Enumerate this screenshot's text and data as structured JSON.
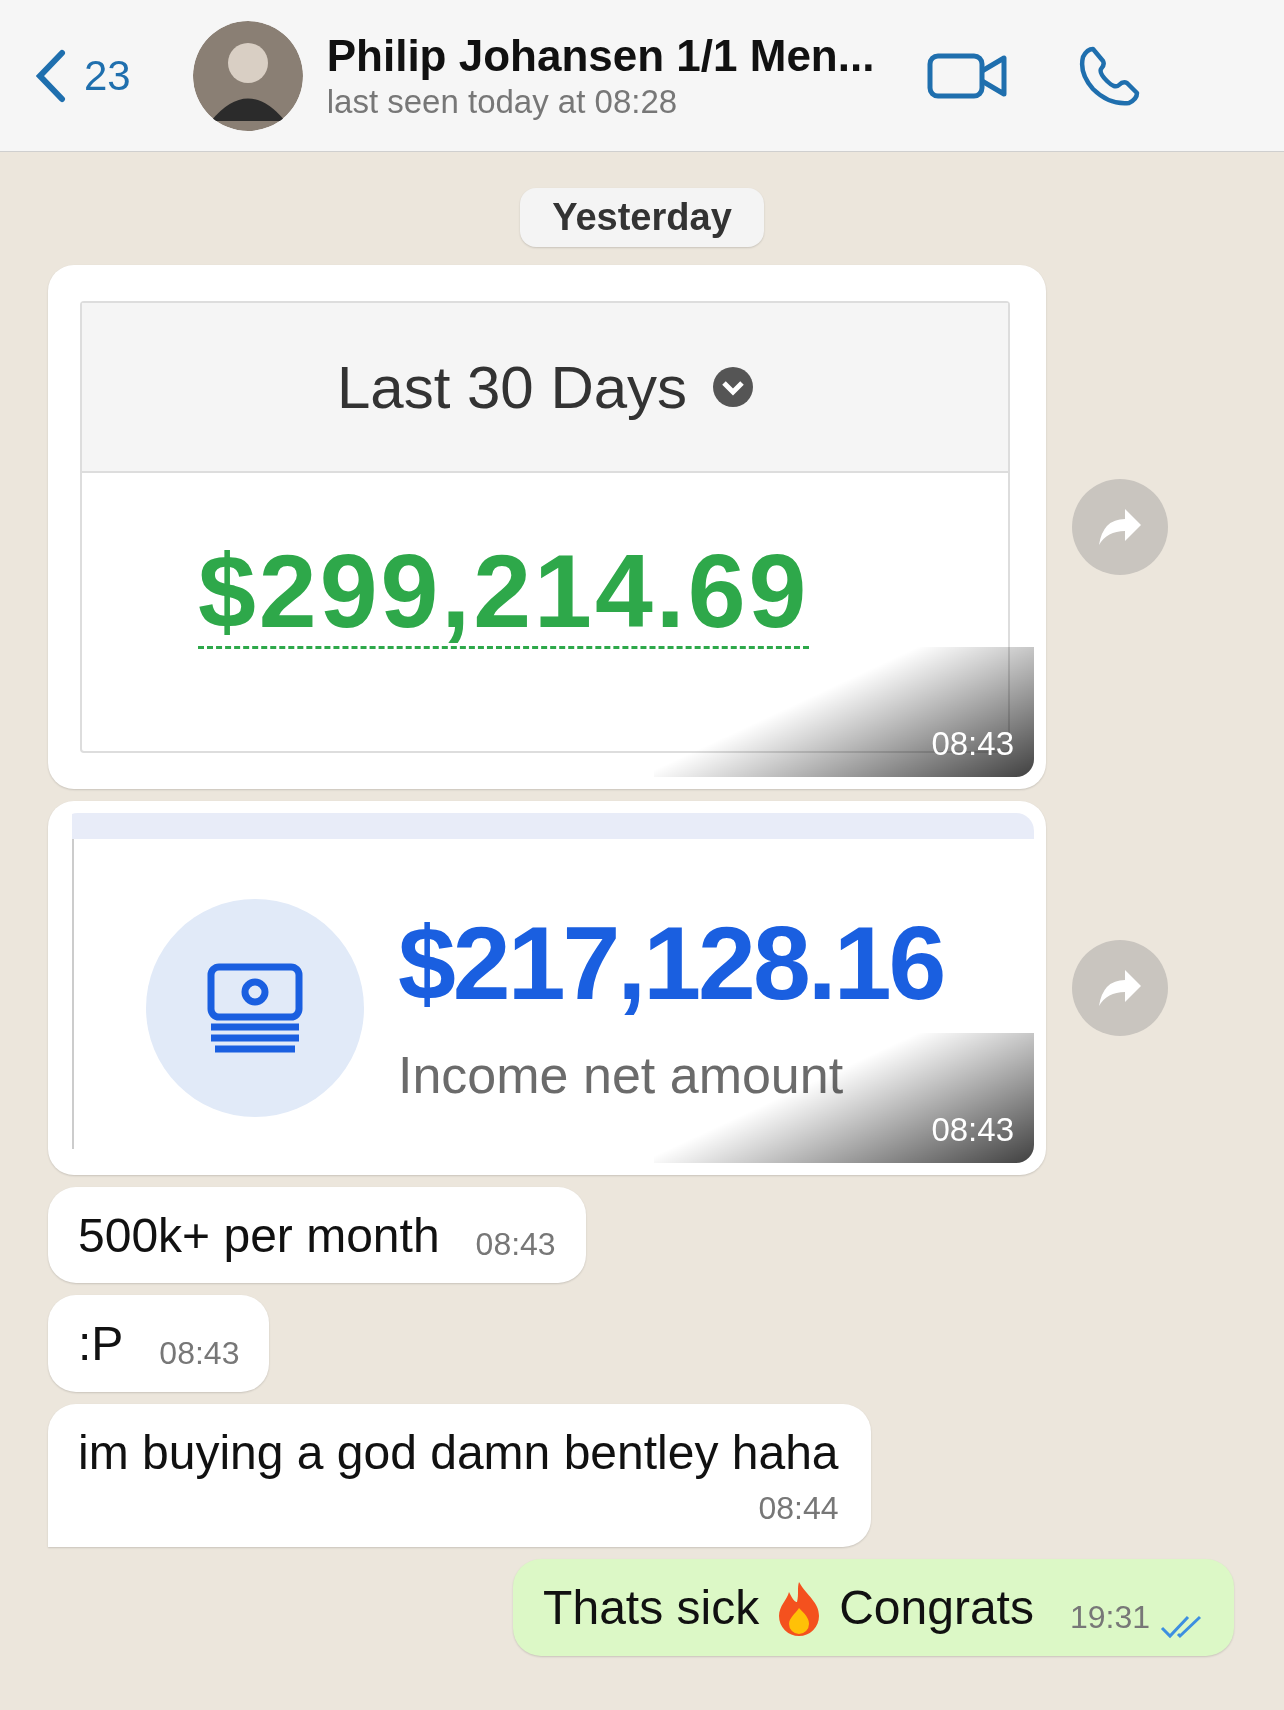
{
  "header": {
    "back_count": "23",
    "contact_name": "Philip Johansen 1/1 Men...",
    "status": "last seen today at 08:28"
  },
  "date_label": "Yesterday",
  "messages": [
    {
      "kind": "image",
      "outgoing": false,
      "image": {
        "kind": "stat_card",
        "period": "Last 30 Days",
        "amount": "$299,214.69"
      },
      "time": "08:43"
    },
    {
      "kind": "image",
      "outgoing": false,
      "image": {
        "kind": "income_card",
        "amount": "$217,128.16",
        "caption": "Income net amount"
      },
      "time": "08:43"
    },
    {
      "kind": "text",
      "outgoing": false,
      "text": "500k+ per month",
      "time": "08:43"
    },
    {
      "kind": "text",
      "outgoing": false,
      "text": ":P",
      "time": "08:43"
    },
    {
      "kind": "text",
      "outgoing": false,
      "text": "im buying a god damn bentley haha",
      "time": "08:44",
      "tail": true
    },
    {
      "kind": "emoji_text",
      "outgoing": true,
      "text_before": "Thats sick",
      "text_after": "Congrats",
      "time": "19:31",
      "read": true
    }
  ]
}
